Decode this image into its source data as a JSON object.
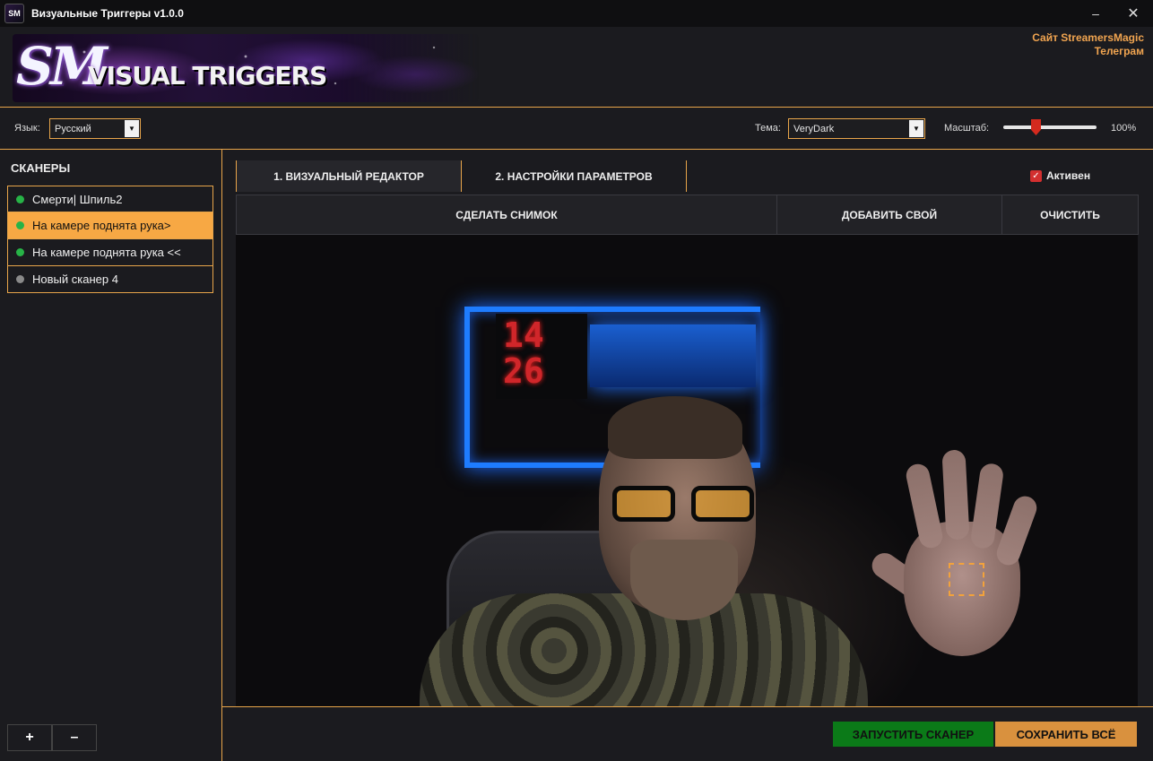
{
  "window": {
    "title": "Визуальные Триггеры v1.0.0",
    "icon_text": "SM",
    "minimize_glyph": "–",
    "close_glyph": "✕"
  },
  "banner": {
    "logo_sm": "SM",
    "logo_text": "VISUAL TRIGGERS",
    "links": [
      "Сайт StreamersMagic",
      "Телеграм"
    ]
  },
  "settings": {
    "language_label": "Язык:",
    "language_value": "Русский",
    "theme_label": "Тема:",
    "theme_value": "VeryDark",
    "scale_label": "Масштаб:",
    "scale_value": "100%",
    "scale_fraction": 0.35
  },
  "scanners": {
    "title": "СКАНЕРЫ",
    "items": [
      {
        "label": "Смерти| Шпиль2",
        "active": true,
        "selected": false
      },
      {
        "label": "На камере поднята рука>",
        "active": true,
        "selected": true
      },
      {
        "label": "На камере поднята рука <<",
        "active": true,
        "selected": false
      },
      {
        "label": "Новый сканер 4",
        "active": false,
        "selected": false
      }
    ],
    "add_label": "+",
    "remove_label": "–"
  },
  "tabs": {
    "visual_editor": "1. ВИЗУАЛЬНЫЙ РЕДАКТОР",
    "parameters": "2. НАСТРОЙКИ ПАРАМЕТРОВ"
  },
  "active_toggle": {
    "label": "Активен",
    "checked": true
  },
  "toolbar": {
    "snapshot": "СДЕЛАТЬ СНИМОК",
    "add_own": "ДОБАВИТЬ СВОЙ",
    "clear": "ОЧИСТИТЬ"
  },
  "camera": {
    "clock_top": "14",
    "clock_bottom": "26"
  },
  "actions": {
    "run_scanner": "ЗАПУСТИТЬ СКАНЕР",
    "save_all": "СОХРАНИТЬ ВСЁ"
  },
  "colors": {
    "accent": "#e8a54a",
    "selected_row": "#f7a844",
    "status_on": "#27b347",
    "status_off": "#8a8a8a",
    "run_button": "#0b7a18",
    "save_button": "#d9913e",
    "checkbox": "#d32f2f"
  }
}
